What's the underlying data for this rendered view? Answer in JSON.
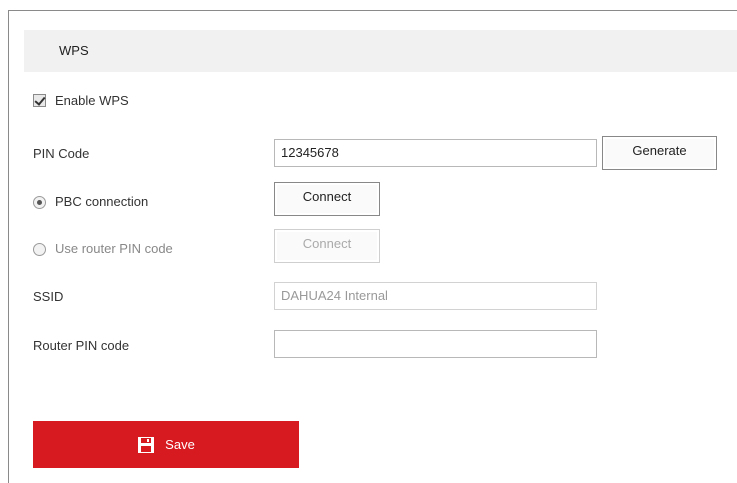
{
  "section": {
    "title": "WPS"
  },
  "enable_wps": {
    "label": "Enable WPS",
    "checked": true
  },
  "pin_code": {
    "label": "PIN Code",
    "value": "12345678",
    "generate_label": "Generate"
  },
  "pbc": {
    "label": "PBC connection",
    "selected": true,
    "button_label": "Connect"
  },
  "router_pin": {
    "label": "Use router PIN code",
    "selected": false,
    "button_label": "Connect"
  },
  "ssid": {
    "label": "SSID",
    "value": "DAHUA24 Internal"
  },
  "router_pin_code": {
    "label": "Router PIN code",
    "value": ""
  },
  "save": {
    "label": "Save"
  },
  "colors": {
    "accent": "#d71920",
    "header_bg": "#f1f1f1"
  }
}
